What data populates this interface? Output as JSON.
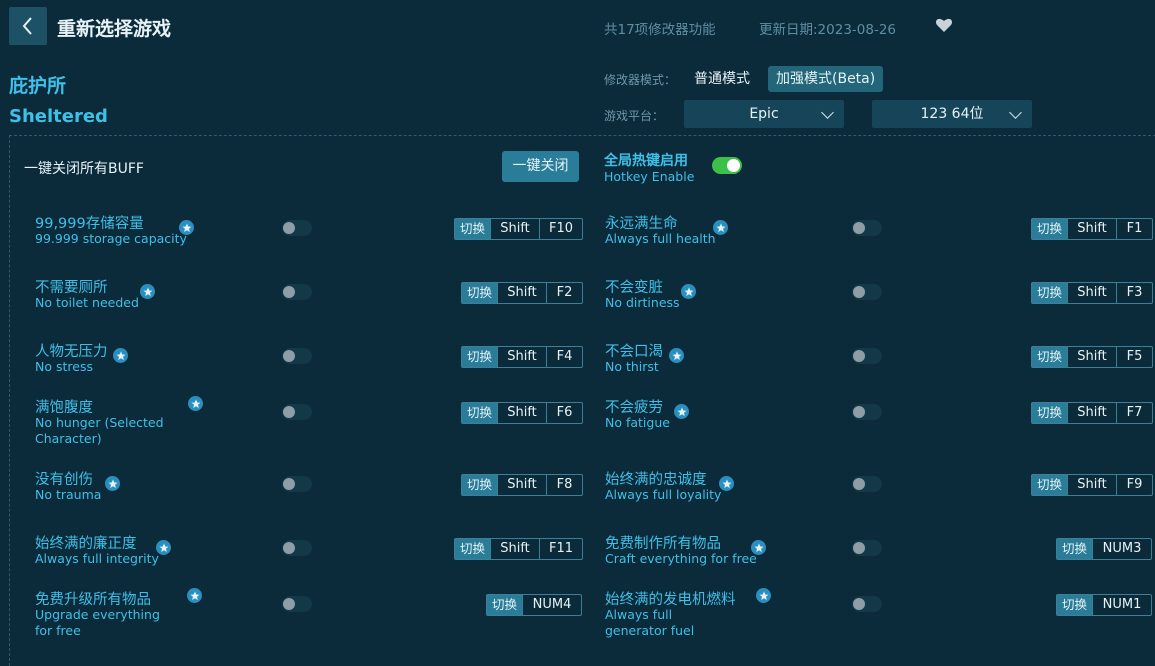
{
  "header": {
    "title": "重新选择游戏",
    "feature_count": "共17项修改器功能",
    "update_date": "更新日期:2023-08-26"
  },
  "game": {
    "name_cn": "庇护所",
    "name_en": "Sheltered"
  },
  "mode": {
    "label": "修改器模式：",
    "normal": "普通模式",
    "enhanced": "加强模式(Beta)",
    "selected": "enhanced"
  },
  "platform": {
    "label": "游戏平台：",
    "store": "Epic",
    "version": "123 64位"
  },
  "controls": {
    "all_buff_label": "一键关闭所有BUFF",
    "close_all_button": "一键关闭",
    "hotkey_cn": "全局热键启用",
    "hotkey_en": "Hotkey Enable",
    "hotkey_enabled": true
  },
  "switch_label": "切换",
  "cheats": [
    {
      "cn": "99,999存储容量",
      "en": "99.999 storage capacity",
      "keys": [
        "Shift",
        "F10"
      ],
      "enabled": false
    },
    {
      "cn": "永远满生命",
      "en": "Always full health",
      "keys": [
        "Shift",
        "F1"
      ],
      "enabled": false
    },
    {
      "cn": "不需要厕所",
      "en": "No toilet needed",
      "keys": [
        "Shift",
        "F2"
      ],
      "enabled": false
    },
    {
      "cn": "不会变脏",
      "en": "No dirtiness",
      "keys": [
        "Shift",
        "F3"
      ],
      "enabled": false
    },
    {
      "cn": "人物无压力",
      "en": "No stress",
      "keys": [
        "Shift",
        "F4"
      ],
      "enabled": false
    },
    {
      "cn": "不会口渴",
      "en": "No thirst",
      "keys": [
        "Shift",
        "F5"
      ],
      "enabled": false
    },
    {
      "cn": "满饱腹度",
      "en": "No hunger (Selected Character)",
      "keys": [
        "Shift",
        "F6"
      ],
      "enabled": false
    },
    {
      "cn": "不会疲劳",
      "en": "No fatigue",
      "keys": [
        "Shift",
        "F7"
      ],
      "enabled": false
    },
    {
      "cn": "没有创伤",
      "en": "No trauma",
      "keys": [
        "Shift",
        "F8"
      ],
      "enabled": false
    },
    {
      "cn": "始终满的忠诚度",
      "en": "Always full loyality",
      "keys": [
        "Shift",
        "F9"
      ],
      "enabled": false
    },
    {
      "cn": "始终满的廉正度",
      "en": "Always full integrity",
      "keys": [
        "Shift",
        "F11"
      ],
      "enabled": false
    },
    {
      "cn": "免费制作所有物品",
      "en": "Craft everything for free",
      "keys": [
        "NUM3"
      ],
      "enabled": false
    },
    {
      "cn": "免费升级所有物品",
      "en": "Upgrade everything for free",
      "keys": [
        "NUM4"
      ],
      "enabled": false
    },
    {
      "cn": "始终满的发电机燃料",
      "en": "Always full generator fuel",
      "keys": [
        "NUM1"
      ],
      "enabled": false
    }
  ]
}
